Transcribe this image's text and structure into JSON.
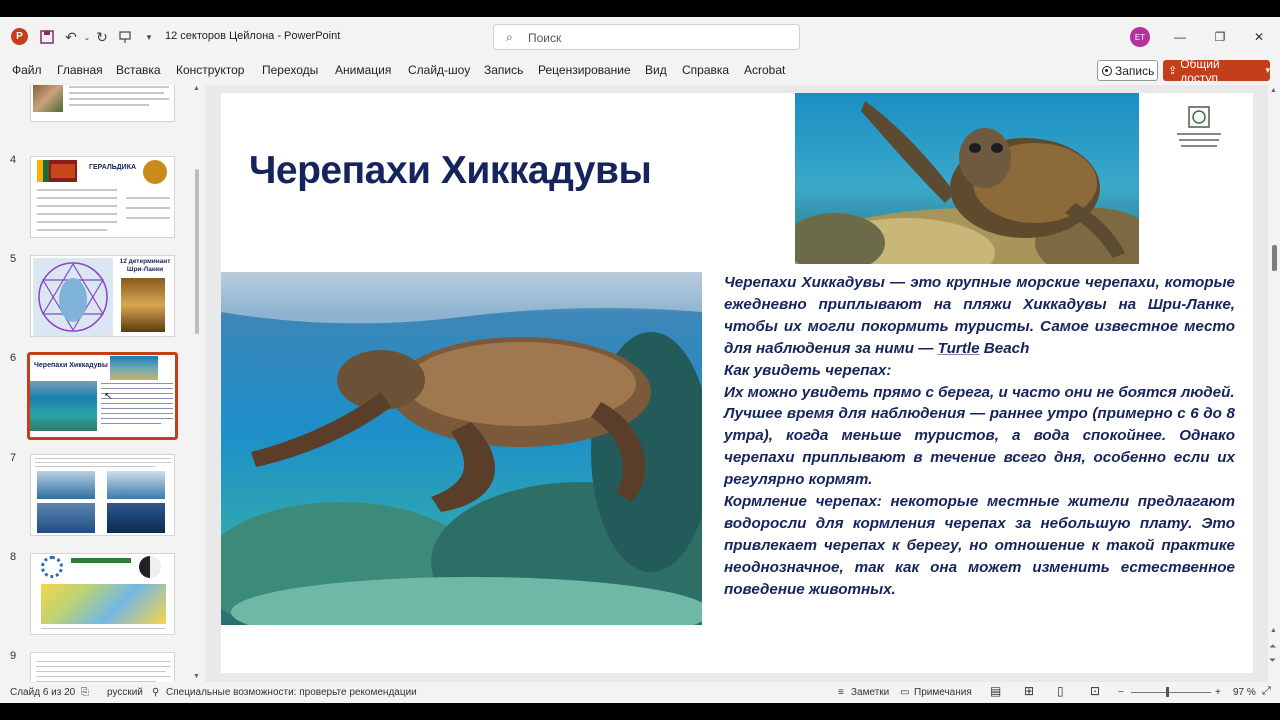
{
  "window": {
    "doc_title": "12 секторов Цейлона  -  PowerPoint",
    "search_placeholder": "Поиск",
    "avatar_initials": "ET"
  },
  "ribbon": {
    "tabs": [
      "Файл",
      "Главная",
      "Вставка",
      "Конструктор",
      "Переходы",
      "Анимация",
      "Слайд-шоу",
      "Запись",
      "Рецензирование",
      "Вид",
      "Справка",
      "Acrobat"
    ],
    "record_label": "Запись",
    "share_label": "Общий доступ"
  },
  "thumbnails": {
    "numbers": [
      "4",
      "5",
      "6",
      "7",
      "8",
      "9"
    ],
    "slide4_title": "ГЕРАЛЬДИКА",
    "slide5_title": "12 детерминант Шри-Ланки",
    "slide6_title": "Черепахи Хиккадувы",
    "selected": "6"
  },
  "slide": {
    "title": "Черепахи Хиккадувы",
    "paragraphs": [
      "Черепахи Хиккадувы — это крупные морские черепахи, которые ежедневно приплывают на пляжи Хиккадувы на Шри-Ланке, чтобы их могли покормить туристы. Самое известное место для наблюдения за ними — ",
      "Как увидеть черепах:",
      "Их можно увидеть прямо с берега, и часто они не боятся людей.",
      "Лучшее время для наблюдения — раннее утро (примерно с 6 до 8 утра), когда меньше туристов, а вода спокойнее. Однако черепахи приплывают в течение всего дня, особенно если их регулярно кормят.",
      "Кормление черепах: некоторые местные жители предлагают водоросли для кормления черепах за небольшую плату. Это привлекает черепах к берегу, но отношение к такой практике неоднозначное, так как она может изменить естественное поведение животных."
    ],
    "link_word": "Turtle",
    "link_tail": " Beach"
  },
  "statusbar": {
    "slide_counter": "Слайд 6 из 20",
    "language": "русский",
    "accessibility": "Специальные возможности: проверьте рекомендации",
    "notes_label": "Заметки",
    "comments_label": "Примечания",
    "zoom": "97 %"
  },
  "colors": {
    "accent": "#c43e1c",
    "title_navy": "#15245c"
  }
}
